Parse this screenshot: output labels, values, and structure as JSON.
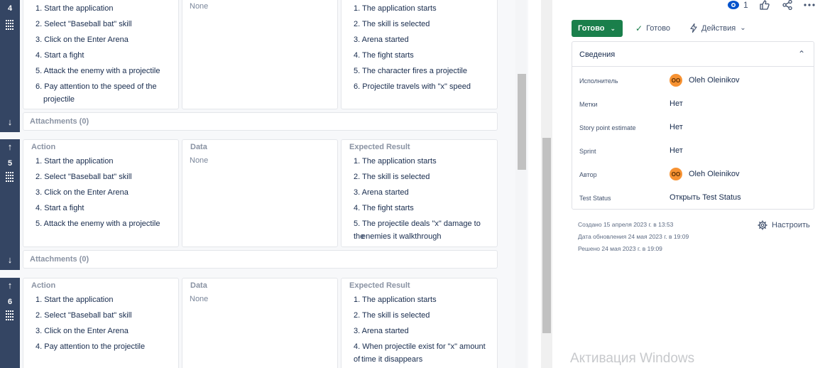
{
  "steps": [
    {
      "number": "4",
      "headers": {
        "action": "",
        "data": "",
        "expected": ""
      },
      "data_value": "None",
      "actions": [
        "1. Start the application",
        "2. Select \"Baseball bat\" skill",
        "3. Click on the Enter Arena",
        "4. Start a fight",
        "5. Attack the enemy with a projectile",
        "6. Pay attention to the speed of the",
        "projectile"
      ],
      "expected": [
        "1. The application starts",
        "2. The skill is selected",
        "3. Arena started",
        "4. The fight starts",
        "5. The character fires a projectile",
        "6. Projectile travels with \"x\" speed"
      ],
      "attachments": "Attachments (0)"
    },
    {
      "number": "5",
      "headers": {
        "action": "Action",
        "data": "Data",
        "expected": "Expected Result"
      },
      "data_value": "None",
      "actions": [
        "1. Start the application",
        "2. Select \"Baseball bat\" skill",
        "3. Click on the Enter Arena",
        "4. Start a fight",
        "5. Attack the enemy with a projectile"
      ],
      "expected": [
        "1. The application starts",
        "2. The skill is selected",
        "3. Arena started",
        "4. The fight starts",
        "5. The projectile deals \"x\" damage to the",
        "enemies it walkthrough"
      ],
      "attachments": "Attachments (0)"
    },
    {
      "number": "6",
      "headers": {
        "action": "Action",
        "data": "Data",
        "expected": "Expected Result"
      },
      "data_value": "None",
      "actions": [
        "1. Start the application",
        "2. Select \"Baseball bat\" skill",
        "3. Click on the Enter Arena",
        "4. Pay attention to the projectile"
      ],
      "expected": [
        "1. The application starts",
        "2. The skill is selected",
        "3. Arena started",
        "4. When projectile exist for \"x\" amount of",
        "time it disappears"
      ],
      "attachments": ""
    }
  ],
  "toolbar": {
    "watchers_count": "1"
  },
  "status": {
    "button_label": "Готово",
    "resolution": "Готово",
    "actions_label": "Действия"
  },
  "details": {
    "title": "Сведения",
    "fields": [
      {
        "label": "Исполнитель",
        "value": "Oleh Oleinikov",
        "avatar": "OO"
      },
      {
        "label": "Метки",
        "value": "Нет",
        "avatar": ""
      },
      {
        "label": "Story point estimate",
        "value": "Нет",
        "avatar": ""
      },
      {
        "label": "Sprint",
        "value": "Нет",
        "avatar": ""
      },
      {
        "label": "Автор",
        "value": "Oleh Oleinikov",
        "avatar": "OO"
      },
      {
        "label": "Test Status",
        "value": "Открыть Test Status",
        "avatar": ""
      }
    ]
  },
  "meta": {
    "created": "Создано 15 апреля 2023 г. в 13:53",
    "updated": "Дата обновления 24 мая 2023 г. в 19:09",
    "resolved": "Решено 24 мая 2023 г. в 19:09"
  },
  "configure_label": "Настроить",
  "watermark": "Активация Windows",
  "colors": {
    "gutter": "#344563",
    "done_button": "#1a7f4b",
    "avatar": "#f79232"
  }
}
